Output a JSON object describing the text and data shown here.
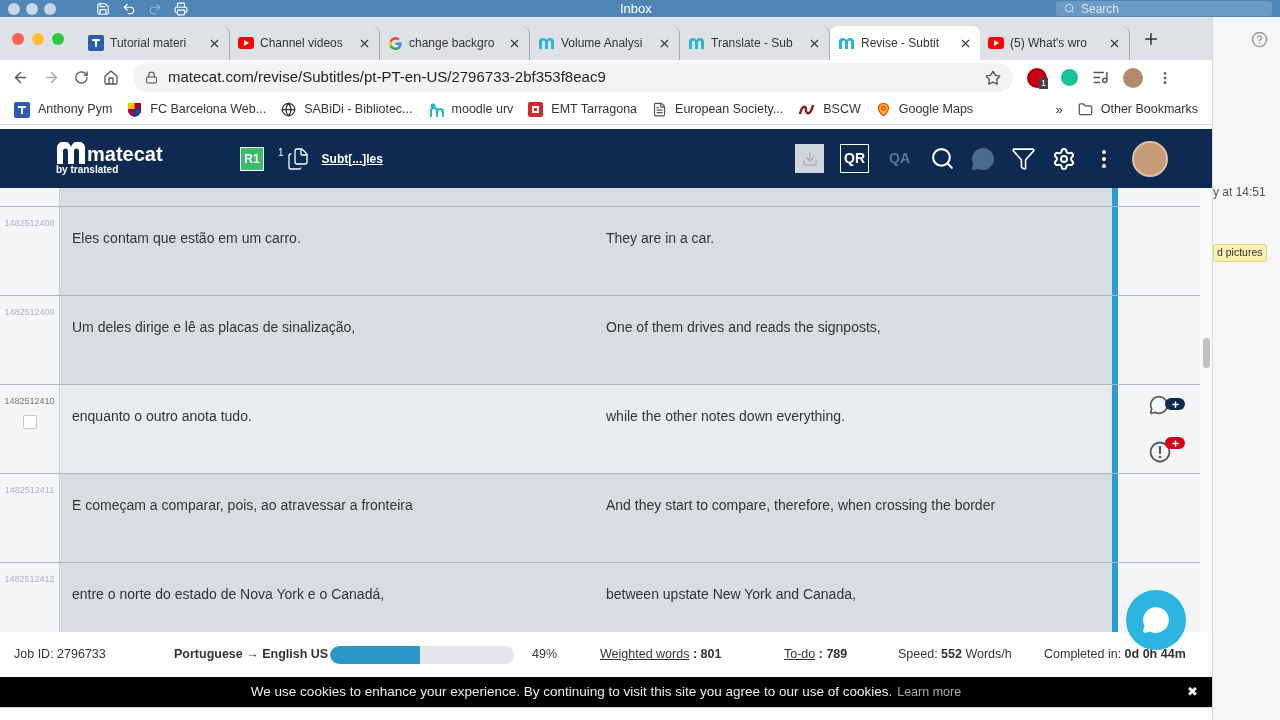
{
  "os_bar": {
    "title": "Inbox",
    "search_placeholder": "Search"
  },
  "tabs": [
    {
      "title": "Tutorial materi",
      "kind": "tutorial",
      "selected": false
    },
    {
      "title": "Channel videos",
      "kind": "youtube",
      "selected": false
    },
    {
      "title": "change backgro",
      "kind": "google",
      "selected": false
    },
    {
      "title": "Volume Analysi",
      "kind": "matecat",
      "selected": false
    },
    {
      "title": "Translate - Sub",
      "kind": "matecat",
      "selected": false
    },
    {
      "title": "Revise - Subtit",
      "kind": "matecat",
      "selected": true
    },
    {
      "title": "(5) What's wro",
      "kind": "youtube",
      "selected": false
    }
  ],
  "address": "matecat.com/revise/Subtitles/pt-PT-en-US/2796733-2bf353f8eac9",
  "extension_badge": "1",
  "bookmarks": [
    {
      "label": "Anthony Pym",
      "kind": "tutorial"
    },
    {
      "label": "FC Barcelona Web...",
      "kind": "crest"
    },
    {
      "label": "SABiDi - Bibliotec...",
      "kind": "globe"
    },
    {
      "label": "moodle urv",
      "kind": "moodle"
    },
    {
      "label": "EMT Tarragona",
      "kind": "emt"
    },
    {
      "label": "European Society...",
      "kind": "doc"
    },
    {
      "label": "BSCW",
      "kind": "bscw"
    },
    {
      "label": "Google Maps",
      "kind": "maps"
    }
  ],
  "bookmarks_more": "»",
  "other_bookmarks": "Other Bookmarks",
  "app_header": {
    "logo": "matecat",
    "logo_sub": "by translated",
    "revision": "R1",
    "file_count": "1",
    "file_name": "Subt[...]les",
    "qr": "QR",
    "qa": "QA"
  },
  "segments": [
    {
      "id": "1482512408",
      "source": "Eles contam que estão em um carro.",
      "target": "They are in a car.",
      "selected": false,
      "checked": false
    },
    {
      "id": "1482512409",
      "source": "Um deles dirige e lê as placas de sinalização,",
      "target": "One of them drives and reads the signposts,",
      "selected": false,
      "checked": false
    },
    {
      "id": "1482512410",
      "source": "enquanto o outro anota tudo.",
      "target": "while the other notes down everything.",
      "selected": true,
      "checked": false
    },
    {
      "id": "1482512411",
      "source": "E começam a comparar, pois, ao atravessar a fronteira",
      "target": "And they start to compare, therefore, when crossing the border",
      "selected": false,
      "checked": false
    },
    {
      "id": "1482512412",
      "source": "entre o norte do estado de Nova York e o Canadá,",
      "target": "between upstate New York and Canada,",
      "selected": false,
      "checked": false
    }
  ],
  "footer": {
    "job_id": "Job ID: 2796733",
    "languages": "Portuguese → English US",
    "level": 0.49,
    "percent": "49%",
    "weighted": {
      "label": "Weighted words",
      "value": ": 801"
    },
    "todo": {
      "label": "To-do",
      "value": ": 789"
    },
    "speed": "Speed: **552** Words/h",
    "completed": "Completed in: **0d 0h 44m**"
  },
  "cookie": {
    "text": "We use cookies to enhance your experience. By continuing to visit this site you agree to our use of cookies.",
    "link": "Learn more",
    "close": "✖"
  },
  "behind": {
    "time": "y at 14:51",
    "tag": "d pictures"
  }
}
